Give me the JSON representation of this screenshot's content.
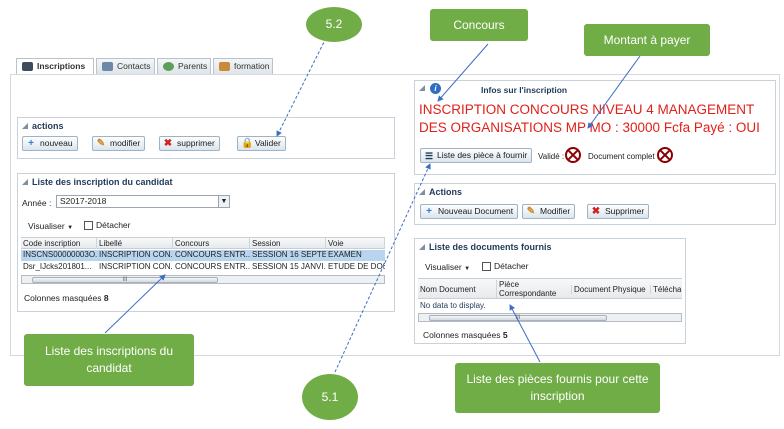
{
  "tabs": [
    {
      "label": "Inscriptions",
      "icon": "user-card-icon",
      "active": true
    },
    {
      "label": "Contacts",
      "icon": "contact-icon",
      "active": false
    },
    {
      "label": "Parents",
      "icon": "people-icon",
      "active": false
    },
    {
      "label": "formation",
      "icon": "chart-icon",
      "active": false
    }
  ],
  "actions_panel": {
    "title": "actions",
    "nouveau": "nouveau",
    "modifier": "modifier",
    "supprimer": "supprimer",
    "valider": "Valider"
  },
  "inscriptions_list": {
    "title": "Liste des inscription du candidat",
    "annee_label": "Année :",
    "annee_value": "S2017-2018",
    "visualiser": "Visualiser",
    "detacher": "Détacher",
    "columns": [
      "Code inscription",
      "Libellé",
      "Concours",
      "Session",
      "Voie"
    ],
    "rows": [
      [
        "INSCNS00000003O...",
        "INSCRIPTION CON...",
        "CONCOURS ENTR...",
        "SESSION 16 SEPTE...",
        "EXAMEN"
      ],
      [
        "Dsr_IJcks201801...",
        "INSCRIPTION CON...",
        "CONCOURS ENTR...",
        "SESSION 15 JANVI...",
        "ETUDE DE DOSS"
      ]
    ],
    "hidden_cols_label": "Colonnes masquées",
    "hidden_cols_count": "8"
  },
  "info_panel": {
    "title": "Infos sur l'inscription",
    "headline": "INSCRIPTION CONCOURS NIVEAU 4 MANAGEMENT DES ORGANISATIONS MP MO : 30000 Fcfa  Payé : OUI",
    "pieces_button": "Liste des pièce à fournir",
    "valide_label": "Validé :",
    "complet_label": "Document complet :"
  },
  "actions2_panel": {
    "title": "Actions",
    "nouveau_doc": "Nouveau Document",
    "modifier": "Modifier",
    "supprimer": "Supprimer"
  },
  "documents_list": {
    "title": "Liste des documents fournis",
    "visualiser": "Visualiser",
    "detacher": "Détacher",
    "columns": [
      "Nom Document",
      "Pièce Correspondante",
      "Document Physique",
      "Télécharg"
    ],
    "empty": "No data to display.",
    "hidden_cols_label": "Colonnes masquées",
    "hidden_cols_count": "5"
  },
  "annotations": {
    "concours": "Concours",
    "montant": "Montant à payer",
    "step_52": "5.2",
    "step_51": "5.1",
    "liste_inscriptions": "Liste des inscriptions du candidat",
    "liste_pieces": "Liste des pièces fournis pour cette inscription"
  },
  "colors": {
    "callout_green": "#70ad47",
    "headline_red": "#e0201a",
    "header_blue": "#1f3a57"
  }
}
